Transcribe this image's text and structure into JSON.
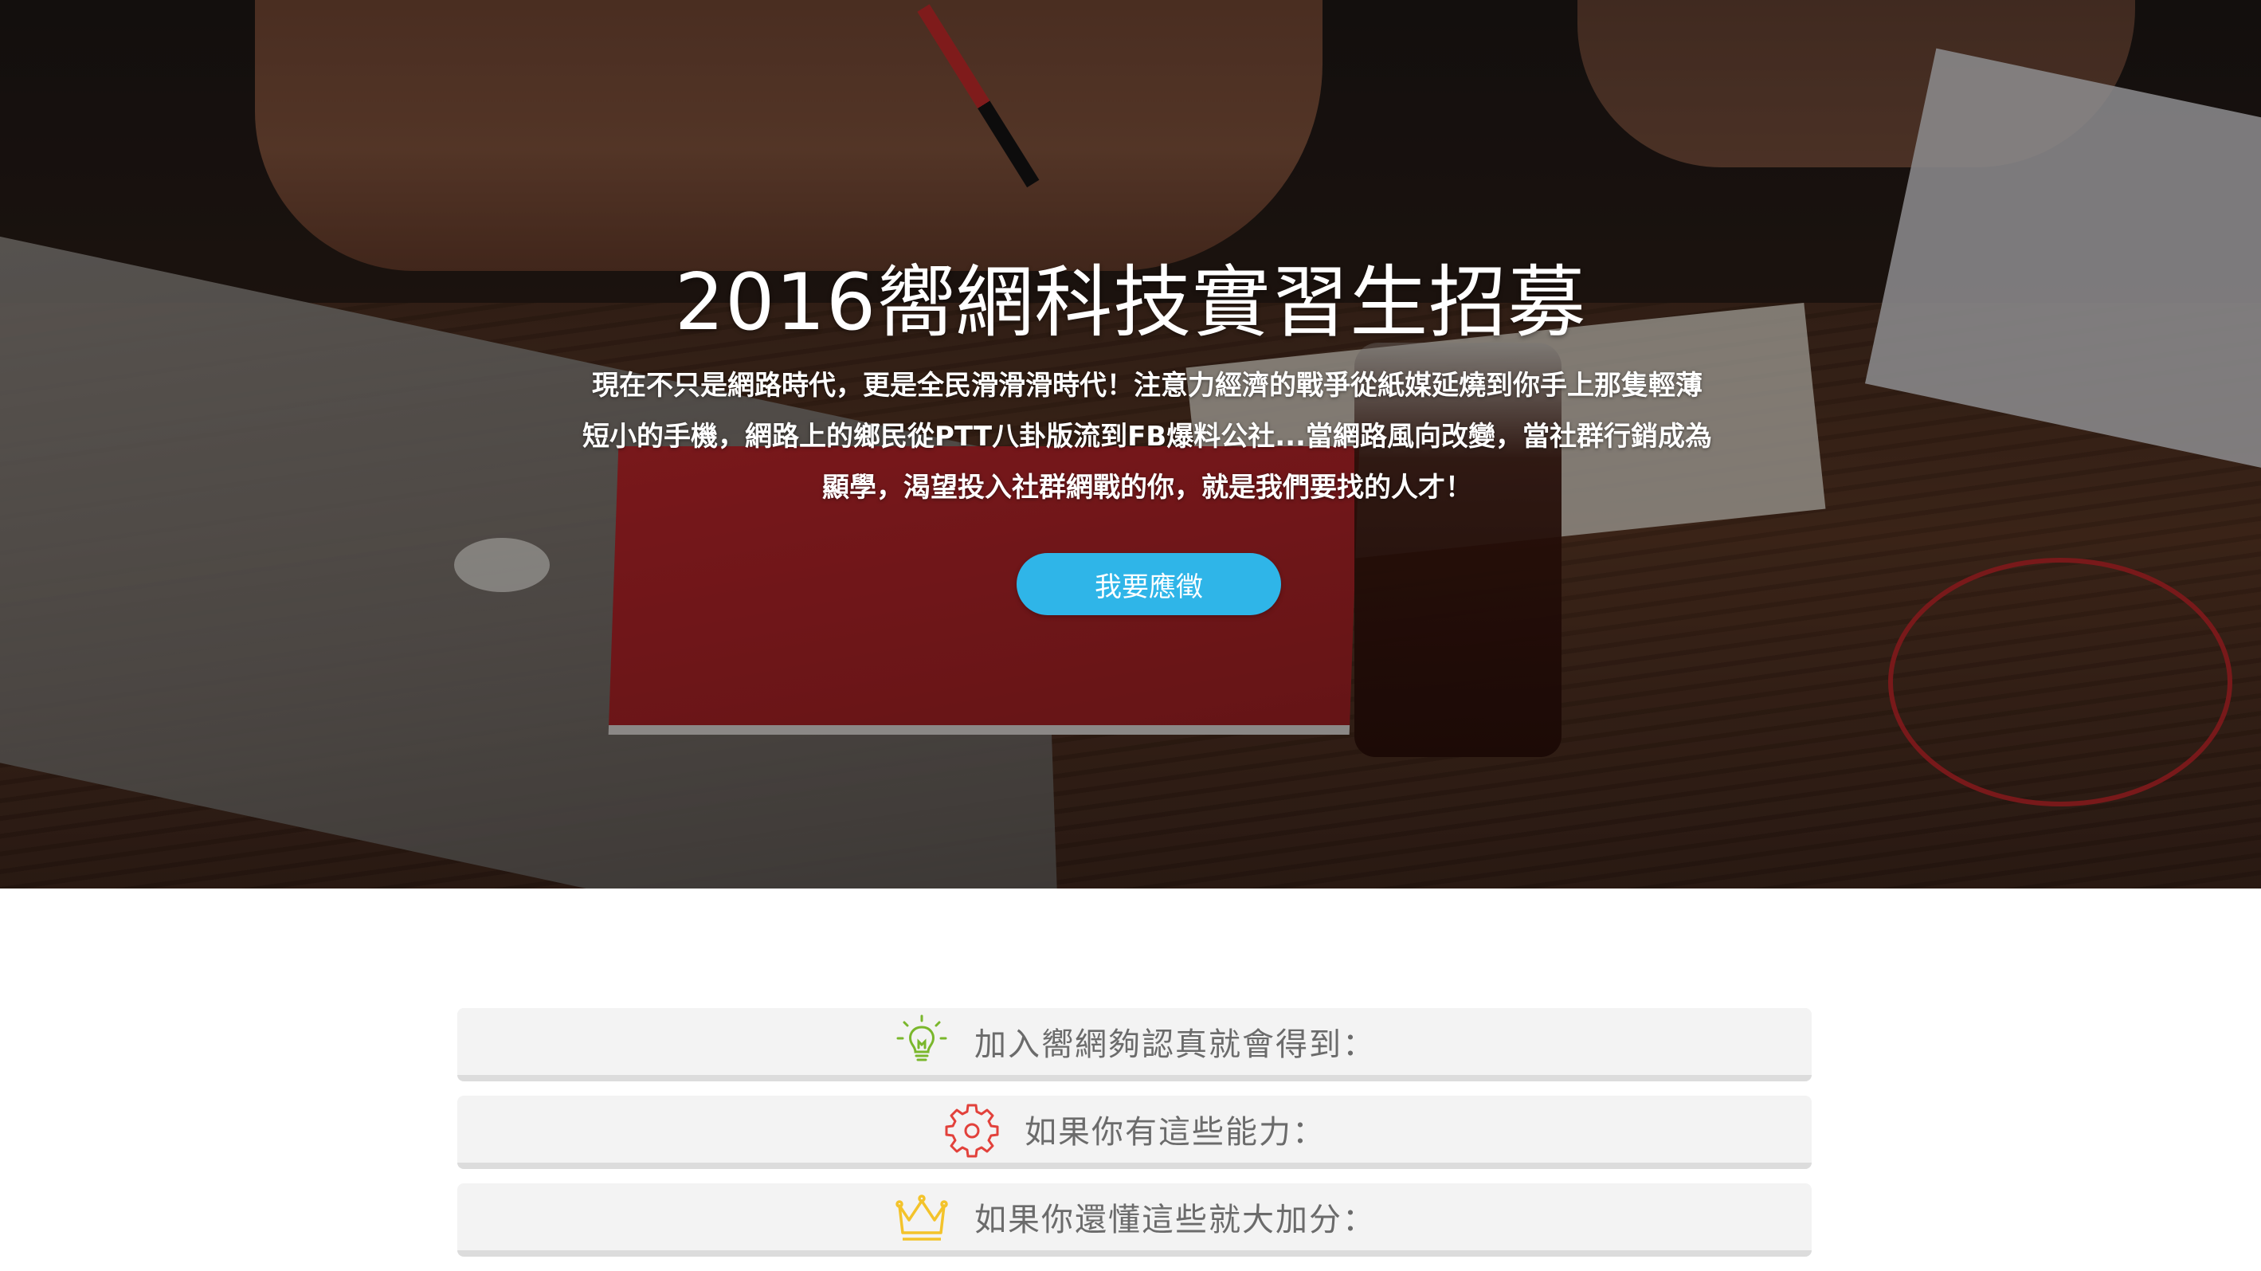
{
  "hero": {
    "title": "2016嚮網科技實習生招募",
    "description_lines": [
      "現在不只是網路時代，更是全民滑滑滑時代！注意力經濟的戰爭從紙媒延燒到你手上那隻輕薄",
      "短小的手機，網路上的鄉民從PTT八卦版流到FB爆料公社...當網路風向改變，當社群行銷成為",
      "顯學，渴望投入社群網戰的你，就是我們要找的人才！"
    ],
    "apply_button": "我要應徵",
    "accent_color": "#2fb5e8"
  },
  "sections": [
    {
      "icon": "lightbulb-icon",
      "icon_color": "#7ab72c",
      "label": "加入嚮網夠認真就會得到："
    },
    {
      "icon": "gear-icon",
      "icon_color": "#e2413b",
      "label": "如果你有這些能力："
    },
    {
      "icon": "crown-icon",
      "icon_color": "#f3c32b",
      "label": "如果你還懂這些就大加分："
    }
  ]
}
